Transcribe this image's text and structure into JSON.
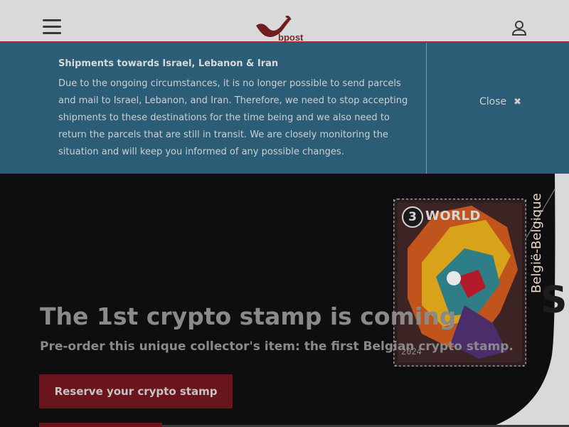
{
  "header": {
    "logo_text": "bpost",
    "brand_color": "#b12a30"
  },
  "alert": {
    "title": "Shipments towards Israel, Lebanon & Iran",
    "body": "Due to the ongoing circumstances, it is no longer possible to send parcels and mail to Israel, Lebanon, and Iran. Therefore, we need to stop accepting shipments to these destinations for the time being and we also need to return the parcels that are still in transit. We are closely monitoring the situation and will keep you informed of any possible changes.",
    "close_label": "Close",
    "close_glyph": "✖",
    "background_color": "#2b5d77"
  },
  "hero": {
    "title": "The 1st crypto stamp is coming",
    "subtitle": "Pre-order this unique collector's item: the first Belgian crypto stamp.",
    "cta_label": "Reserve your crypto stamp",
    "side_letter": "S",
    "stamp": {
      "value": "3",
      "world": "WORLD",
      "country": "België-Belgique",
      "year": "2024"
    }
  },
  "icons": [
    "hamburger-menu-icon",
    "bpost-logo",
    "user-account-icon",
    "close-icon"
  ]
}
